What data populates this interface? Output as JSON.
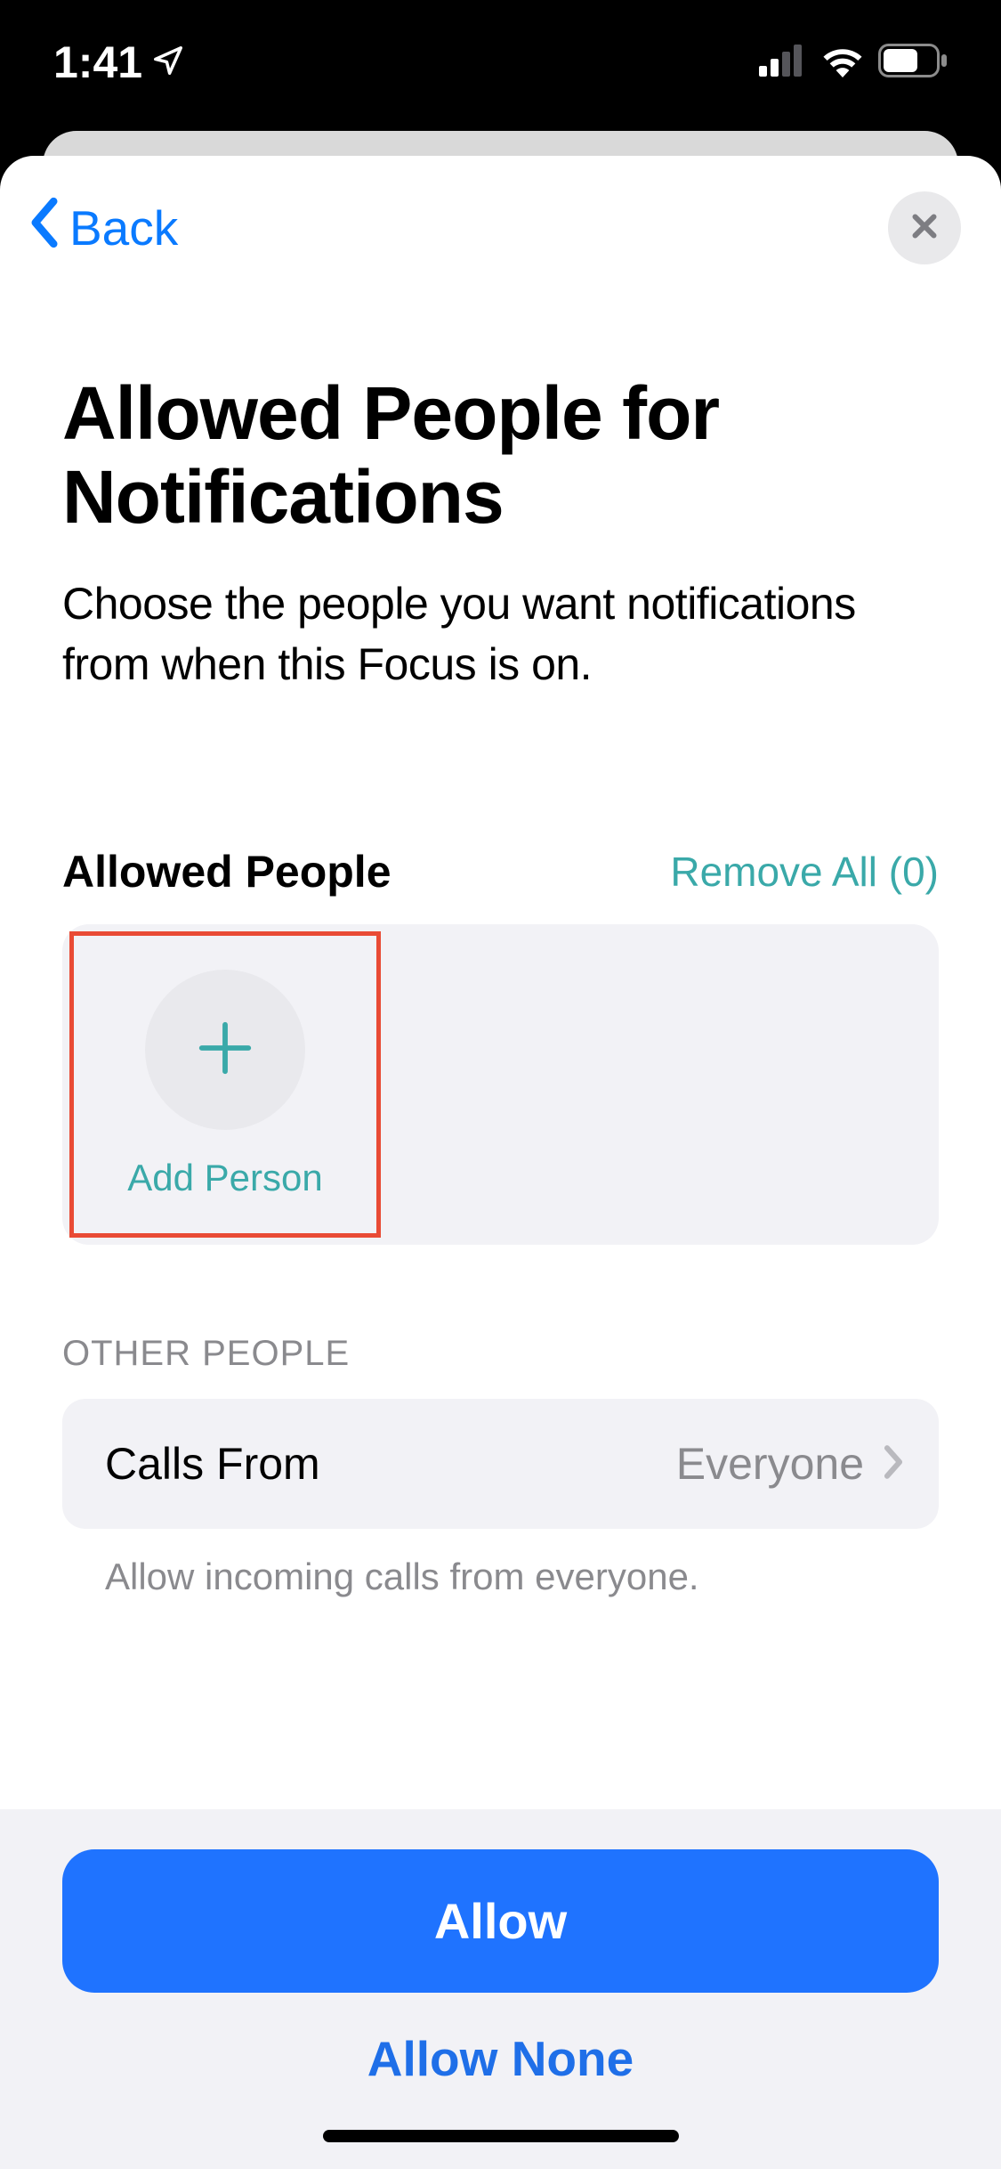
{
  "statusBar": {
    "time": "1:41"
  },
  "nav": {
    "backLabel": "Back"
  },
  "header": {
    "title": "Allowed People for Notifications",
    "subtitle": "Choose the people you want notifications from when this Focus is on."
  },
  "allowedSection": {
    "title": "Allowed People",
    "removeAllLabel": "Remove All (0)",
    "addPersonLabel": "Add Person"
  },
  "otherSection": {
    "groupLabel": "OTHER PEOPLE",
    "callsFromLabel": "Calls From",
    "callsFromValue": "Everyone",
    "footerText": "Allow incoming calls from everyone."
  },
  "actions": {
    "allowLabel": "Allow",
    "allowNoneLabel": "Allow None"
  }
}
